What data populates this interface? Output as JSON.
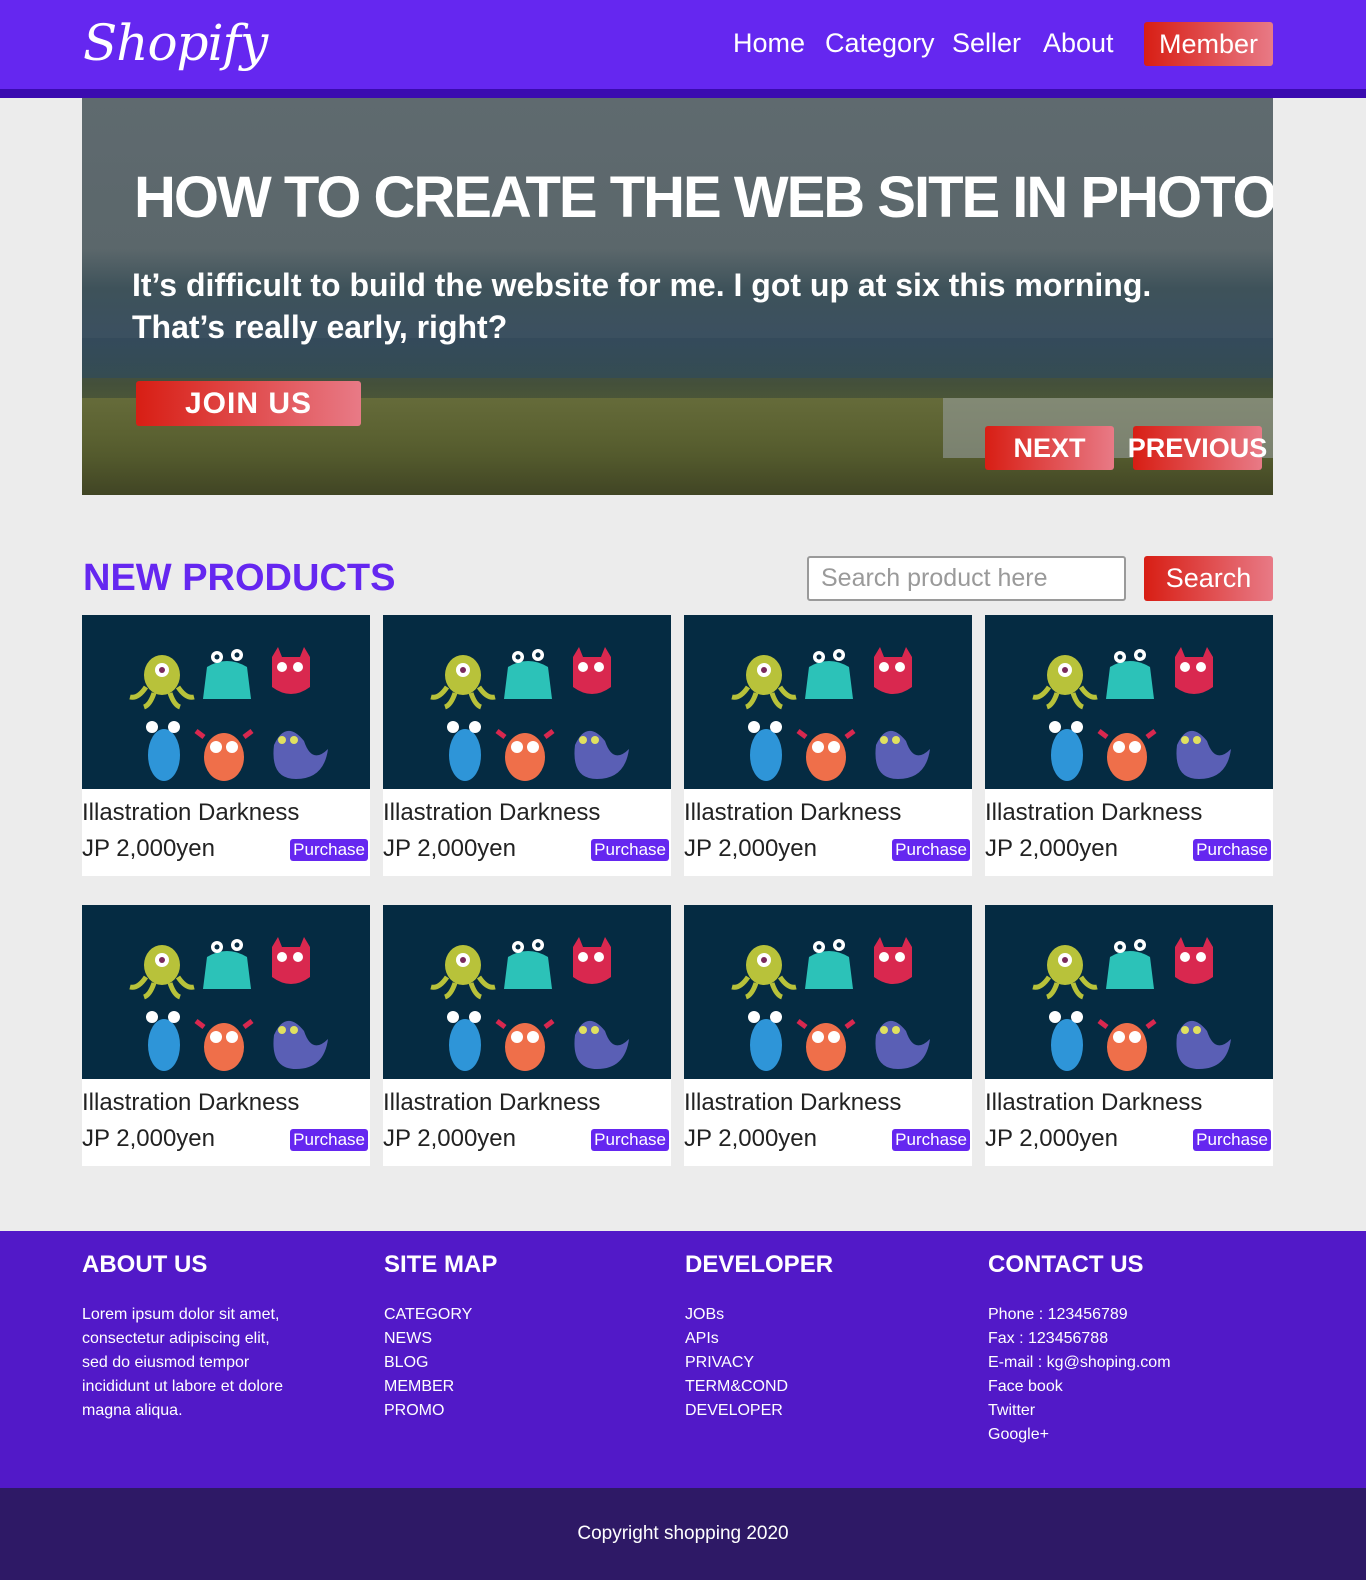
{
  "header": {
    "logo": "Shopify",
    "nav": [
      "Home",
      "Category",
      "Seller",
      "About"
    ],
    "member": "Member"
  },
  "hero": {
    "title": "HOW TO CREATE THE WEB SITE IN PHOTOSHOP",
    "text": "It’s difficult to build the website for me. I got up at six this morning. That’s really early, right?",
    "join": "JOIN US",
    "next": "NEXT",
    "previous": "PREVIOUS"
  },
  "products": {
    "title": "NEW PRODUCTS",
    "search_placeholder": "Search product here",
    "search_button": "Search",
    "items": [
      {
        "name": "Illastration Darkness",
        "price": "JP 2,000yen",
        "action": "Purchase"
      },
      {
        "name": "Illastration Darkness",
        "price": "JP 2,000yen",
        "action": "Purchase"
      },
      {
        "name": "Illastration Darkness",
        "price": "JP 2,000yen",
        "action": "Purchase"
      },
      {
        "name": "Illastration Darkness",
        "price": "JP 2,000yen",
        "action": "Purchase"
      },
      {
        "name": "Illastration Darkness",
        "price": "JP 2,000yen",
        "action": "Purchase"
      },
      {
        "name": "Illastration Darkness",
        "price": "JP 2,000yen",
        "action": "Purchase"
      },
      {
        "name": "Illastration Darkness",
        "price": "JP 2,000yen",
        "action": "Purchase"
      },
      {
        "name": "Illastration Darkness",
        "price": "JP 2,000yen",
        "action": "Purchase"
      }
    ]
  },
  "footer": {
    "about": {
      "title": "ABOUT US",
      "lines": [
        "Lorem ipsum dolor sit amet,",
        "consectetur adipiscing elit,",
        "sed do eiusmod tempor",
        "incididunt ut labore et dolore",
        "magna aliqua."
      ]
    },
    "sitemap": {
      "title": "SITE MAP",
      "links": [
        "CATEGORY",
        "NEWS",
        "BLOG",
        "MEMBER",
        "PROMO"
      ]
    },
    "developer": {
      "title": "DEVELOPER",
      "links": [
        "JOBs",
        "APIs",
        "PRIVACY",
        "TERM&COND",
        "DEVELOPER"
      ]
    },
    "contact": {
      "title": "CONTACT US",
      "lines": [
        "Phone : 123456789",
        "Fax : 123456788",
        "E-mail : kg@shoping.com",
        "Face book",
        "Twitter",
        "Google+"
      ]
    },
    "copyright": "Copyright shopping 2020"
  },
  "colors": {
    "brand": "#6527f0",
    "accent_red": "#d81e14",
    "footer": "#5219c8",
    "copyright_bar": "#2e1966",
    "card_image_bg": "#052b42"
  }
}
